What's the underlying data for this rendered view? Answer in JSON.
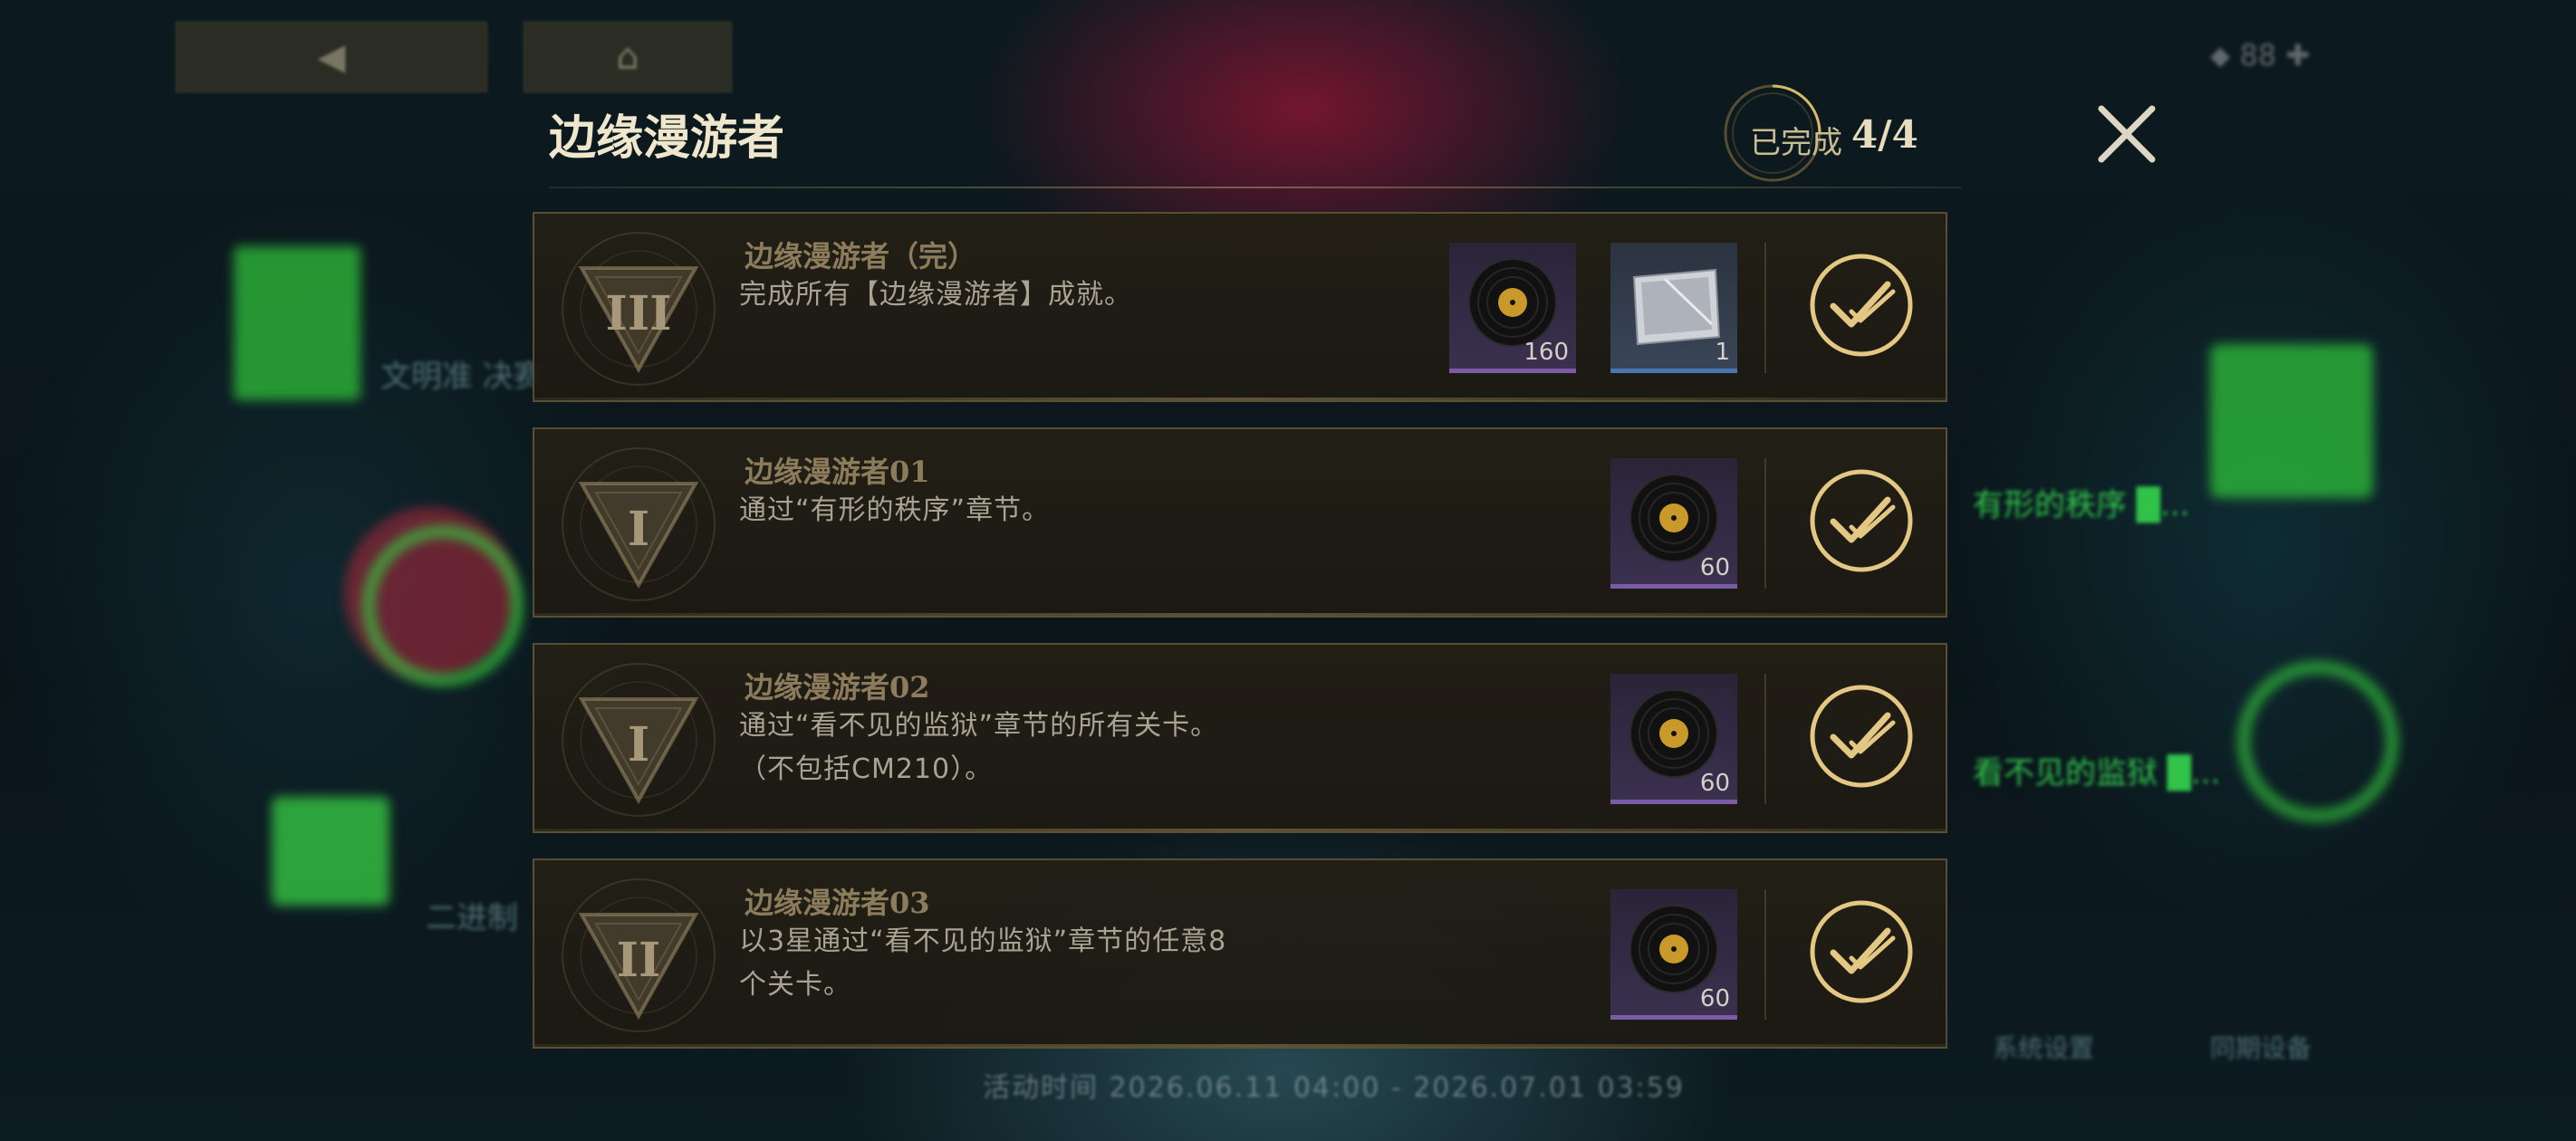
{
  "panel": {
    "title": "边缘漫游者",
    "progress_label": "已完成",
    "progress_value": "4/4"
  },
  "achievements": [
    {
      "title": "边缘漫游者（完）",
      "description": "完成所有【边缘漫游者】成就。",
      "badge_numeral": "III",
      "rewards": [
        {
          "type": "record-disc",
          "count": "160",
          "rarity": "purple"
        },
        {
          "type": "metal-card",
          "count": "1",
          "rarity": "blue"
        }
      ]
    },
    {
      "title": "边缘漫游者01",
      "description": "通过“有形的秩序”章节。",
      "badge_numeral": "I",
      "rewards": [
        {
          "type": "record-disc",
          "count": "60",
          "rarity": "purple"
        }
      ]
    },
    {
      "title": "边缘漫游者02",
      "description": "通过“看不见的监狱”章节的所有关卡。（不包括CM210）。",
      "badge_numeral": "I",
      "rewards": [
        {
          "type": "record-disc",
          "count": "60",
          "rarity": "purple"
        }
      ]
    },
    {
      "title": "边缘漫游者03",
      "description": "以3星通过“看不见的监狱”章节的任意8个关卡。",
      "badge_numeral": "II",
      "rewards": [
        {
          "type": "record-disc",
          "count": "60",
          "rarity": "purple"
        }
      ]
    }
  ],
  "colors": {
    "accent_gold": "#e3c783",
    "background_green": "#3bd64a",
    "card_bg": "#221f16"
  }
}
